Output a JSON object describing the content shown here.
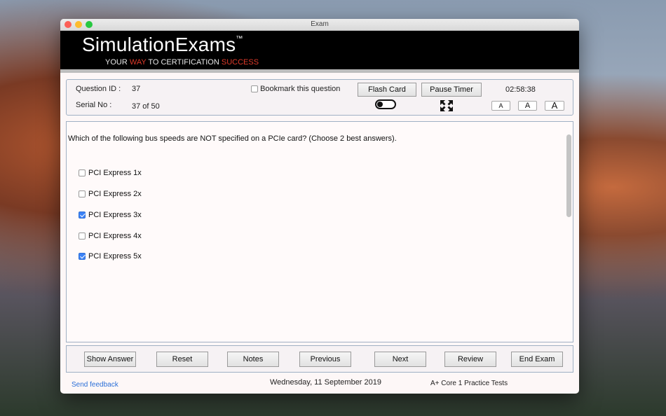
{
  "window": {
    "title": "Exam"
  },
  "brand": {
    "name": "SimulationExams",
    "tm": "™",
    "tagline": {
      "part1": "YOUR ",
      "highlight1": "WAY",
      "part2": " TO CERTIFICATION ",
      "highlight2": "SUCCESS"
    }
  },
  "info": {
    "question_id_label": "Question ID :",
    "question_id": "37",
    "serial_label": "Serial No :",
    "serial_value": "37 of 50",
    "bookmark_label": "Bookmark this question",
    "flash_card_label": "Flash Card",
    "pause_timer_label": "Pause Timer",
    "timer": "02:58:38",
    "font_small": "A",
    "font_medium": "A",
    "font_large": "A"
  },
  "question": {
    "text": "Which of the following bus speeds are NOT specified on a PCIe card? (Choose 2 best answers).",
    "options": [
      {
        "label": "PCI Express 1x",
        "checked": false
      },
      {
        "label": "PCI Express 2x",
        "checked": false
      },
      {
        "label": "PCI Express 3x",
        "checked": true
      },
      {
        "label": "PCI Express 4x",
        "checked": false
      },
      {
        "label": "PCI Express 5x",
        "checked": true
      }
    ]
  },
  "nav": {
    "show_answer": "Show Answer",
    "reset": "Reset",
    "notes": "Notes",
    "previous": "Previous",
    "next": "Next",
    "review": "Review",
    "end_exam": "End Exam"
  },
  "footer": {
    "feedback": "Send feedback",
    "date": "Wednesday, 11 September 2019",
    "product": "A+ Core 1 Practice Tests"
  },
  "colors": {
    "accent_check": "#3b82f6",
    "link": "#2a6fd8",
    "brand_red": "#e03a2a"
  }
}
